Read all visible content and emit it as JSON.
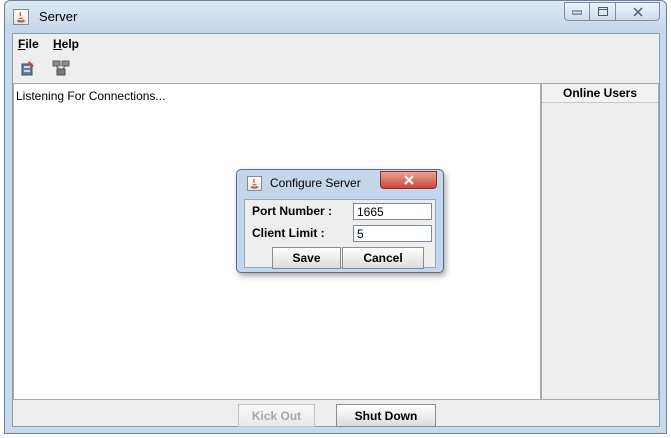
{
  "window": {
    "title": "Server",
    "icon": "java-app-icon"
  },
  "menubar": {
    "file": {
      "mnemonic": "F",
      "rest": "ile"
    },
    "help": {
      "mnemonic": "H",
      "rest": "elp"
    }
  },
  "toolbar": {
    "icons": [
      "configure-server-icon",
      "network-icon"
    ]
  },
  "main": {
    "log_text": "Listening For Connections..."
  },
  "users": {
    "header": "Online Users"
  },
  "bottom": {
    "kick_label": "Kick Out",
    "shutdown_label": "Shut Down"
  },
  "dialog": {
    "title": "Configure Server",
    "port_label": "Port Number :",
    "port_value": "1665",
    "limit_label": "Client Limit :",
    "limit_value": "5",
    "save_label": "Save",
    "cancel_label": "Cancel"
  },
  "colors": {
    "window_frame": "#c9d9ec",
    "close_button": "#c74a35"
  }
}
